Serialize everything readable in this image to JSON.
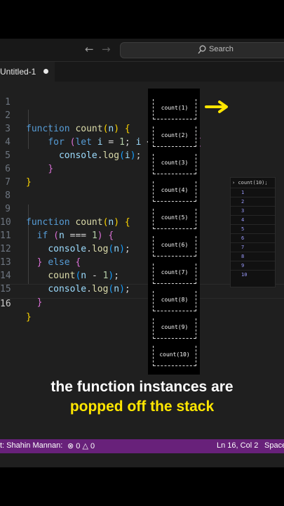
{
  "titlebar": {
    "search_placeholder": "Search"
  },
  "tab": {
    "label": "Untitled-1"
  },
  "editor": {
    "line_numbers": [
      "1",
      "2",
      "3",
      "4",
      "5",
      "6",
      "7",
      "8",
      "9",
      "10",
      "11",
      "12",
      "13",
      "14",
      "15",
      "16"
    ],
    "active_line": "16"
  },
  "stack": {
    "frames": [
      "count(1)",
      "count(2)",
      "count(3)",
      "count(4)",
      "count(5)",
      "count(6)",
      "count(7)",
      "count(8)",
      "count(9)",
      "count(10)"
    ]
  },
  "console": {
    "input": "count(10);",
    "outputs": [
      "1",
      "2",
      "3",
      "4",
      "5",
      "6",
      "7",
      "8",
      "9",
      "10"
    ]
  },
  "caption": {
    "line1": "the function instances are",
    "line2": "popped off the stack"
  },
  "statusbar": {
    "author": "t: Shahin Mannan:",
    "errors": "0",
    "warnings": "0",
    "position": "Ln 16, Col 2",
    "indent": "Space"
  },
  "colors": {
    "statusbar_bg": "#68217a",
    "caption_highlight": "#ffe600",
    "arrow": "#ffe600"
  }
}
